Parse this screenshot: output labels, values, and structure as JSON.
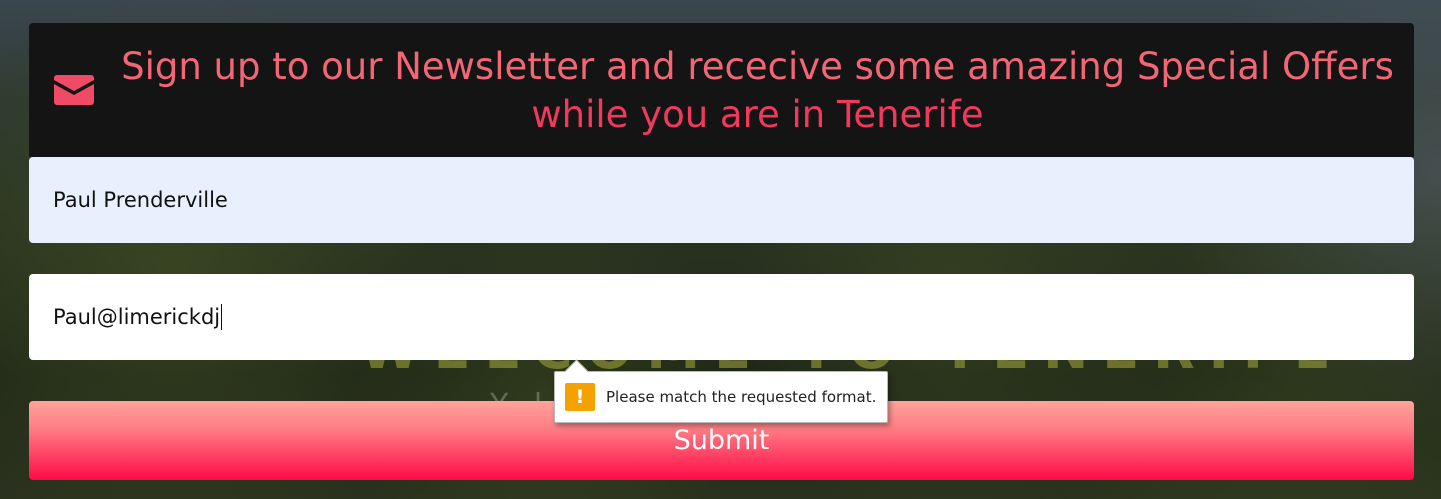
{
  "background": {
    "heading": "WELCOME TO TENERIFE",
    "subheading": "Y         l"
  },
  "banner": {
    "icon": "envelope-icon",
    "line1": "Sign up to our Newsletter and rececive some amazing Special Offers",
    "line2": "while you are in Tenerife"
  },
  "form": {
    "name_value": "Paul Prenderville",
    "email_value": "Paul@limerickdj",
    "submit_label": "Submit"
  },
  "validation": {
    "icon": "warning-icon",
    "message": "Please match the requested format."
  },
  "colors": {
    "banner_bg": "#141414",
    "accent_pink": "#f26676",
    "accent_red": "#f0395c",
    "warning": "#f5a100",
    "autofill_bg": "#e8f0fd"
  }
}
